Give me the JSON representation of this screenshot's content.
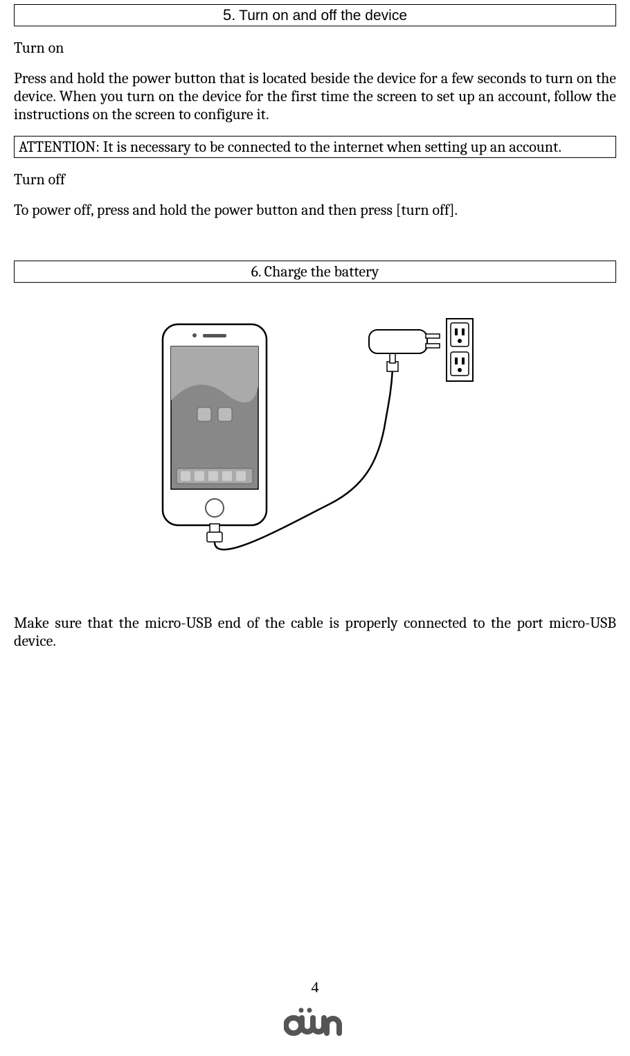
{
  "section5": {
    "title_num": "5.",
    "title_text": "Turn on and off the device",
    "turn_on_heading": "Turn on",
    "turn_on_body": "Press and hold the power button that is located beside the device for a few seconds to turn on the device. When you turn on the device for the first time the screen to set up an account, follow the instructions on the screen to configure it.",
    "attention": "ATTENTION: It is necessary to be connected to the internet when setting up an account.",
    "turn_off_heading": "Turn off",
    "turn_off_body": "To power off, press and hold the power button and then press [turn off]."
  },
  "section6": {
    "title": "6. Charge the battery",
    "body": "Make sure that the micro-USB end of the cable is properly connected to the port micro-USB device."
  },
  "page_number": "4",
  "logo_text": "öwn"
}
